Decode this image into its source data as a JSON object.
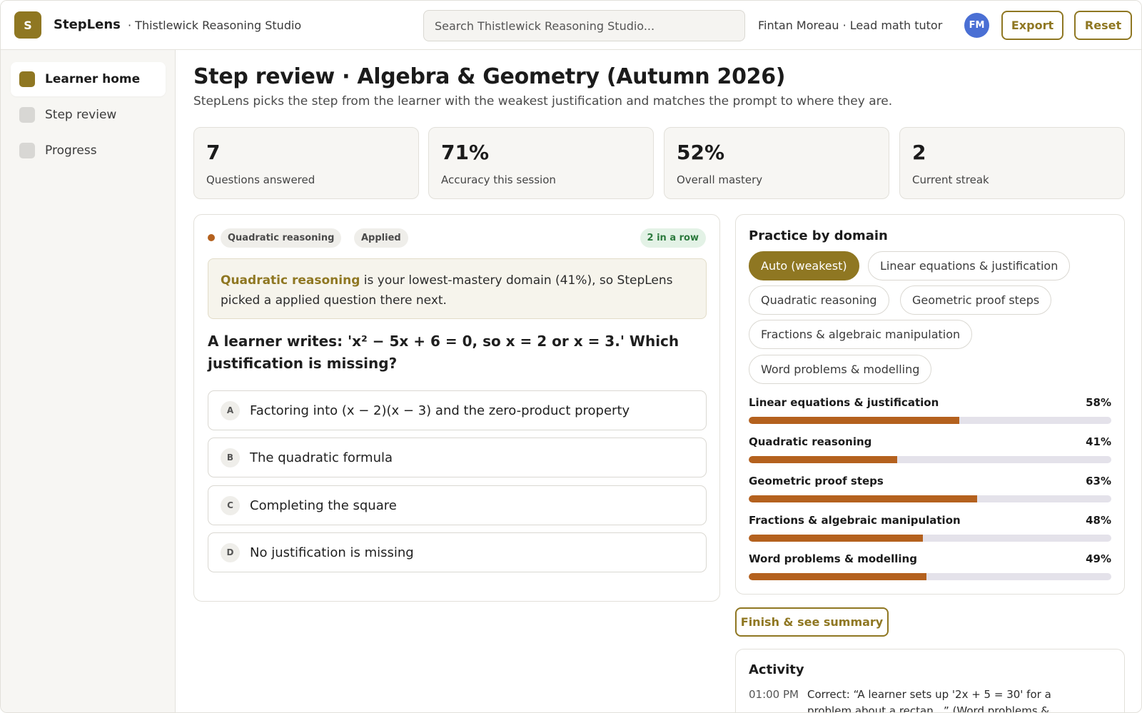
{
  "header": {
    "logo_letter": "S",
    "brand": "StepLens",
    "workspace": "· Thistlewick Reasoning Studio",
    "search_placeholder": "Search Thistlewick Reasoning Studio...",
    "user": "Fintan Moreau · Lead math tutor",
    "avatar_initials": "FM",
    "export_label": "Export",
    "reset_label": "Reset"
  },
  "sidebar": {
    "items": [
      {
        "label": "Learner home",
        "active": true
      },
      {
        "label": "Step review",
        "active": false
      },
      {
        "label": "Progress",
        "active": false
      }
    ]
  },
  "main": {
    "title": "Step review · Algebra & Geometry (Autumn 2026)",
    "subtitle": "StepLens picks the step from the learner with the weakest justification and matches the prompt to where they are."
  },
  "stats": [
    {
      "value": "7",
      "label": "Questions answered"
    },
    {
      "value": "71%",
      "label": "Accuracy this session"
    },
    {
      "value": "52%",
      "label": "Overall mastery"
    },
    {
      "value": "2",
      "label": "Current streak"
    }
  ],
  "question": {
    "tags": [
      "Quadratic reasoning",
      "Applied"
    ],
    "streak": "2 in a row",
    "callout_domain": "Quadratic reasoning",
    "callout_rest": " is your lowest-mastery domain (41%), so StepLens picked a applied question there next.",
    "prompt": "A learner writes: 'x² − 5x + 6 = 0, so x = 2 or x = 3.' Which justification is missing?",
    "options": [
      {
        "letter": "A",
        "text": "Factoring into (x − 2)(x − 3) and the zero-product property"
      },
      {
        "letter": "B",
        "text": "The quadratic formula"
      },
      {
        "letter": "C",
        "text": "Completing the square"
      },
      {
        "letter": "D",
        "text": "No justification is missing"
      }
    ]
  },
  "practice": {
    "title": "Practice by domain",
    "chips": [
      {
        "label": "Auto (weakest)",
        "active": true
      },
      {
        "label": "Linear equations & justification",
        "active": false
      },
      {
        "label": "Quadratic reasoning",
        "active": false
      },
      {
        "label": "Geometric proof steps",
        "active": false
      },
      {
        "label": "Fractions & algebraic manipulation",
        "active": false
      },
      {
        "label": "Word problems & modelling",
        "active": false
      }
    ],
    "domains": [
      {
        "name": "Linear equations & justification",
        "pct_label": "58%",
        "value": 58
      },
      {
        "name": "Quadratic reasoning",
        "pct_label": "41%",
        "value": 41
      },
      {
        "name": "Geometric proof steps",
        "pct_label": "63%",
        "value": 63
      },
      {
        "name": "Fractions & algebraic manipulation",
        "pct_label": "48%",
        "value": 48
      },
      {
        "name": "Word problems & modelling",
        "pct_label": "49%",
        "value": 49
      }
    ],
    "accent_color": "#b4611e"
  },
  "finish_label": "Finish & see summary",
  "activity": {
    "title": "Activity",
    "entries": [
      {
        "time": "01:00 PM",
        "text": "Correct: “A learner sets up '2x + 5 = 30' for a problem about a rectan...” (Word problems &"
      }
    ]
  },
  "colors": {
    "brand": "#8f7722",
    "avatar": "#4a6fd4",
    "streak_bg": "#e3f2e6",
    "streak_text": "#2d7a3e"
  }
}
